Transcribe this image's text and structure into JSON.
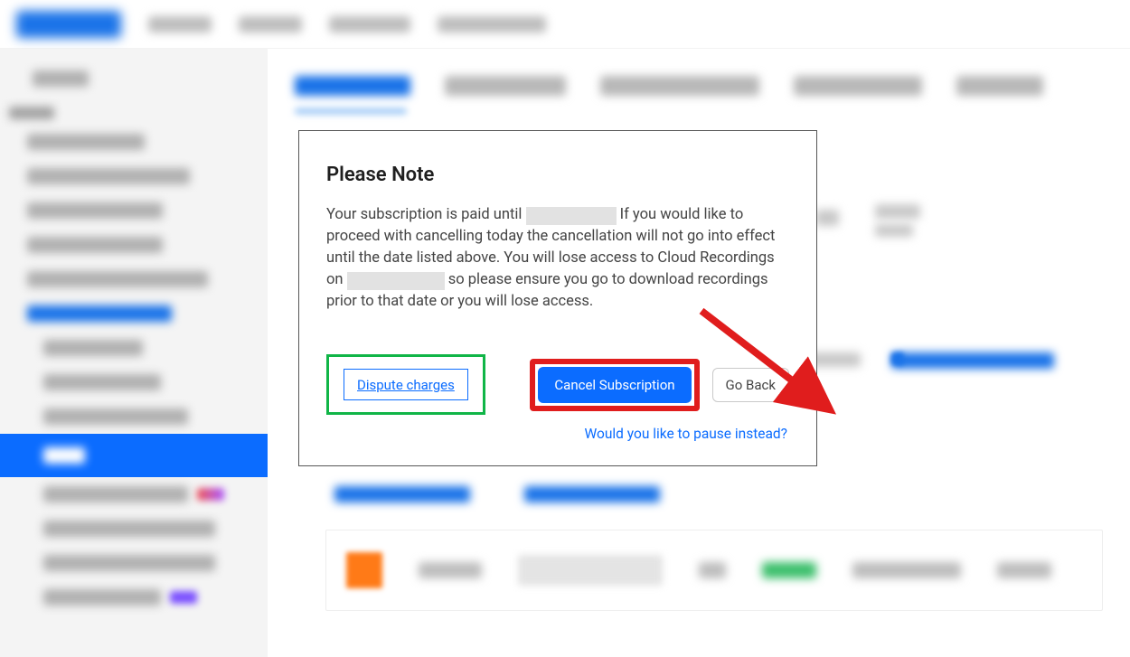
{
  "modal": {
    "title": "Please Note",
    "body_part1": "Your subscription is paid until ",
    "body_part2": " If you would like to proceed with cancelling today the cancellation will not go into effect until the date listed above. You will lose access to Cloud Recordings on ",
    "body_part3": " so please ensure you go to download recordings prior to that date or you will lose access.",
    "dispute_label": "Dispute charges",
    "cancel_label": "Cancel Subscription",
    "go_back_label": "Go Back",
    "pause_prompt": "Would you like to pause instead?"
  },
  "annotations": {
    "green_highlight": "dispute-charges",
    "red_highlight": "cancel-subscription",
    "arrow_target": "cancel-subscription"
  }
}
